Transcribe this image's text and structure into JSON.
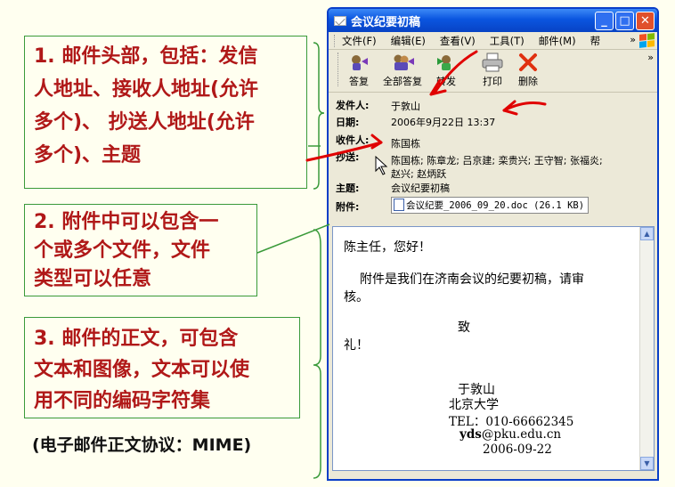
{
  "notes": {
    "note1": {
      "line1": "1. 邮件头部，包括：发信",
      "line2": "人地址、接收人地址(允许",
      "line3": "多个)、  抄送人地址(允许",
      "line4": "多个)、主题"
    },
    "note2": {
      "line1": "2. 附件中可以包含一",
      "line2": "个或多个文件，文件",
      "line3": "类型可以任意"
    },
    "note3": {
      "line1": "3. 邮件的正文，可包含",
      "line2": "文本和图像，文本可以使",
      "line3": "用不同的编码字符集"
    },
    "footer": "(电子邮件正文协议：MIME)"
  },
  "window": {
    "title": "会议纪要初稿",
    "menu": [
      "文件(F)",
      "编辑(E)",
      "查看(V)",
      "工具(T)",
      "邮件(M)",
      "帮"
    ],
    "menu_more": "»",
    "toolbar": [
      {
        "label": "答复",
        "icon": "reply-icon"
      },
      {
        "label": "全部答复",
        "icon": "reply-all-icon"
      },
      {
        "label": "转发",
        "icon": "forward-icon"
      },
      {
        "label": "打印",
        "icon": "printer-icon"
      },
      {
        "label": "删除",
        "icon": "delete-icon"
      }
    ],
    "toolbar_more": "»"
  },
  "headers": {
    "from_label": "发件人:",
    "from": "于敦山",
    "date_label": "日期:",
    "date": "2006年9月22日 13:37",
    "to_label": "收件人:",
    "to": "陈国栋",
    "cc_label": "抄送:",
    "cc_line1": "陈国栋; 陈章龙; 吕京建; 栾贵兴; 王守智; 张福炎;",
    "cc_line2": "赵兴; 赵炳跃",
    "subject_label": "主题:",
    "subject": "会议纪要初稿",
    "attach_label": "附件:",
    "attachment": "会议纪要_2006_09_20.doc (26.1 KB)"
  },
  "body": {
    "greeting": "陈主任，您好！",
    "line1": "附件是我们在济南会议的纪要初稿，请审",
    "line2": "核。",
    "closing1": "致",
    "closing2": "礼！",
    "sig_name": "于敦山",
    "sig_org": "北京大学",
    "sig_tel": "TEL：010-66662345",
    "sig_email_user": "yds",
    "sig_email_domain": "@pku.edu.cn",
    "sig_date": "2006-09-22"
  },
  "colors": {
    "note_text": "#b01818",
    "note_border": "#3a9a3a",
    "arrow": "#e00000",
    "title_bar": "#0a55e0"
  }
}
